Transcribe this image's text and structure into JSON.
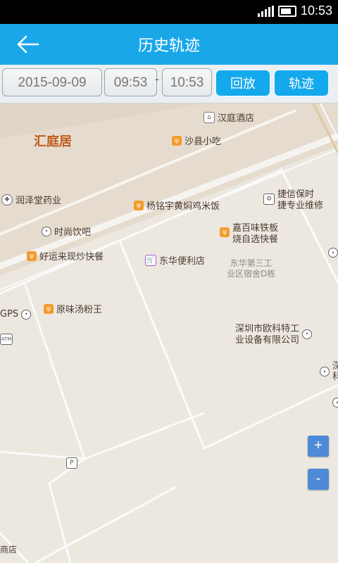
{
  "status": {
    "time": "10:53"
  },
  "header": {
    "title": "历史轨迹"
  },
  "controls": {
    "date": "2015-09-09",
    "start_time": "09:53",
    "separator": "-",
    "end_time": "10:53",
    "playback_label": "回放",
    "track_label": "轨迹"
  },
  "map": {
    "district": "汇庭居",
    "pois": {
      "hotel": "汉庭酒店",
      "snack": "沙县小吃",
      "pharmacy": "润泽堂药业",
      "chicken": "杨铭宇黄焖鸡米饭",
      "auto_line1": "捷信保时",
      "auto_line2": "捷专业维修",
      "drink": "时尚饮吧",
      "tieban_line1": "嘉百味铁板",
      "tieban_line2": "烧自选快餐",
      "fastfood": "好运来现炒快餐",
      "store": "东华便利店",
      "dorm_line1": "东华第三工",
      "dorm_line2": "业区宿舍D栋",
      "gps": "GPS",
      "noodle": "原味汤粉王",
      "company_line1": "深圳市欧科特工",
      "company_line2": "业设备有限公司",
      "atm": "ATM",
      "right_edge1": "深",
      "right_edge2": "科",
      "bottom_left": "商店",
      "parking": "P"
    },
    "zoom_in": "+",
    "zoom_out": "-"
  }
}
